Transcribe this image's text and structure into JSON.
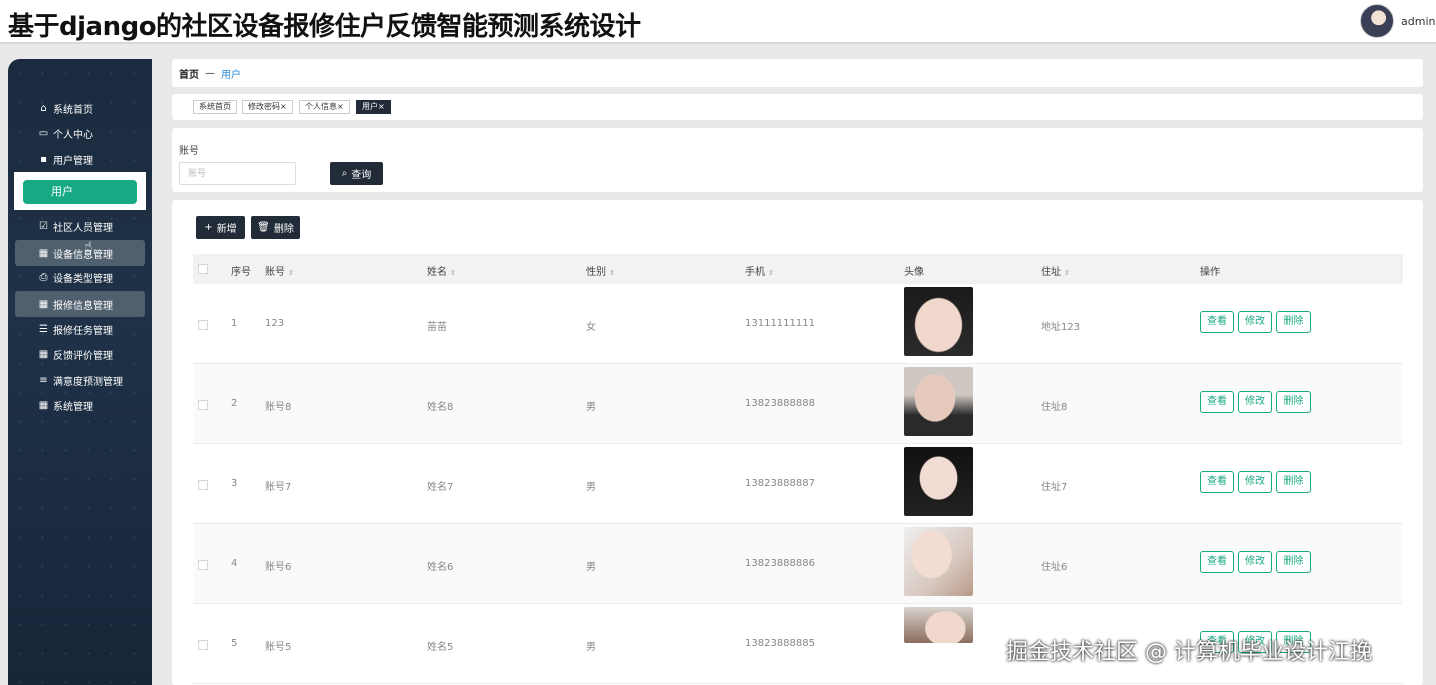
{
  "header": {
    "title": "基于django的社区设备报修住户反馈智能预测系统设计",
    "username": "admin"
  },
  "sidebar": {
    "items": [
      {
        "label": "系统首页",
        "icon": "home-icon"
      },
      {
        "label": "个人中心",
        "icon": "card-icon"
      },
      {
        "label": "用户管理",
        "icon": "clipboard-icon"
      },
      {
        "label": "用户",
        "icon": "",
        "active": true
      },
      {
        "label": "社区人员管理",
        "icon": "check-square-icon"
      },
      {
        "label": "设备信息管理",
        "icon": "grid-icon"
      },
      {
        "label": "设备类型管理",
        "icon": "printer-icon"
      },
      {
        "label": "报修信息管理",
        "icon": "grid-icon"
      },
      {
        "label": "报修任务管理",
        "icon": "list-icon"
      },
      {
        "label": "反馈评价管理",
        "icon": "grid-icon"
      },
      {
        "label": "满意度预测管理",
        "icon": "sliders-icon"
      },
      {
        "label": "系统管理",
        "icon": "grid-icon"
      }
    ]
  },
  "breadcrumb": {
    "home": "首页",
    "separator": "—",
    "current": "用户"
  },
  "tabs": [
    {
      "label": "系统首页",
      "closable": false
    },
    {
      "label": "修改密码",
      "closable": true
    },
    {
      "label": "个人信息",
      "closable": true
    },
    {
      "label": "用户",
      "closable": true,
      "active": true
    }
  ],
  "search": {
    "label": "账号",
    "placeholder": "账号",
    "button": "查询"
  },
  "actions": {
    "add": "新增",
    "delete": "删除"
  },
  "table": {
    "columns": [
      "序号",
      "账号",
      "姓名",
      "性别",
      "手机",
      "头像",
      "住址",
      "操作"
    ],
    "rows": [
      {
        "index": "1",
        "account": "123",
        "name": "苗苗",
        "gender": "女",
        "phone": "13111111111",
        "address": "地址123"
      },
      {
        "index": "2",
        "account": "账号8",
        "name": "姓名8",
        "gender": "男",
        "phone": "13823888888",
        "address": "住址8"
      },
      {
        "index": "3",
        "account": "账号7",
        "name": "姓名7",
        "gender": "男",
        "phone": "13823888887",
        "address": "住址7"
      },
      {
        "index": "4",
        "account": "账号6",
        "name": "姓名6",
        "gender": "男",
        "phone": "13823888886",
        "address": "住址6"
      },
      {
        "index": "5",
        "account": "账号5",
        "name": "姓名5",
        "gender": "男",
        "phone": "13823888885",
        "address": ""
      }
    ],
    "row_actions": {
      "view": "查看",
      "edit": "修改",
      "delete": "删除"
    }
  },
  "watermark": "掘金技术社区 @ 计算机毕业设计江挽",
  "colors": {
    "accent": "#17a983",
    "dark_button": "#222b38",
    "sidebar_bg": "#1b2a3e",
    "link": "#2a8bd8"
  }
}
